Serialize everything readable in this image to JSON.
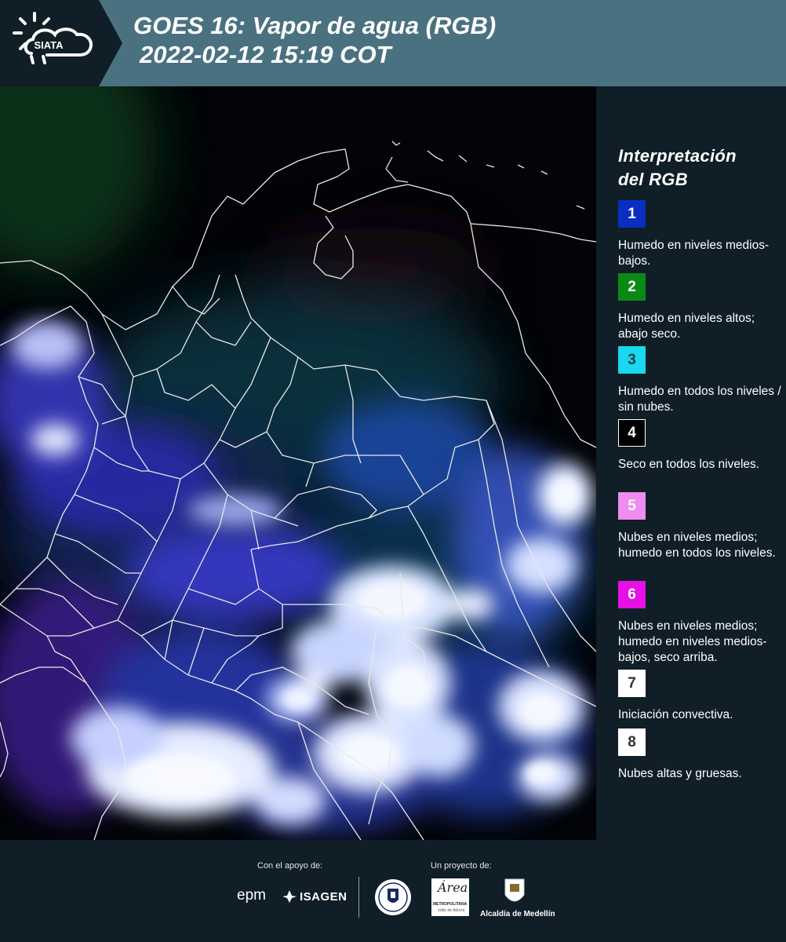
{
  "header": {
    "logo_text": "SIATA",
    "title_line1": "GOES 16: Vapor de agua (RGB)",
    "title_line2": "2022-02-12 15:19 COT",
    "background_color": "#4a7180",
    "logo_panel_color": "#0f1e27"
  },
  "legend": {
    "title_line1": "Interpretación",
    "title_line2": "del RGB",
    "items": [
      {
        "number": "1",
        "color": "#0a2ec2",
        "text_color": "#ffffff",
        "text": "Humedo en niveles medios-bajos."
      },
      {
        "number": "2",
        "color": "#0a8a14",
        "text_color": "#ffffff",
        "text": "Humedo en niveles altos; abajo seco."
      },
      {
        "number": "3",
        "color": "#19d8f0",
        "text_color": "#1a3c46",
        "text": "Humedo en todos los niveles / sin nubes."
      },
      {
        "number": "4",
        "color": "#000000",
        "text_color": "#ffffff",
        "text": "Seco en todos los niveles."
      },
      {
        "number": "5",
        "color": "#f08cf0",
        "text_color": "#ffffff",
        "text": "Nubes en niveles medios; humedo en todos los niveles."
      },
      {
        "number": "6",
        "color": "#e610e6",
        "text_color": "#ffffff",
        "text": "Nubes en niveles medios; humedo en niveles medios-bajos, seco arriba."
      },
      {
        "number": "7",
        "color": "#ffffff",
        "text_color": "#333333",
        "text": "Iniciación convectiva."
      },
      {
        "number": "8",
        "color": "#ffffff",
        "text_color": "#333333",
        "text": "Nubes altas y gruesas."
      }
    ]
  },
  "footer": {
    "support_label": "Con el apoyo de:",
    "project_label": "Un proyecto de:",
    "epm": "epm",
    "isagen": "ISAGEN",
    "area_logo": "Área",
    "area_sub1": "METROPOLITANA",
    "area_sub2": "Valle de Aburrá",
    "alcaldia": "Alcaldía de Medellín"
  }
}
